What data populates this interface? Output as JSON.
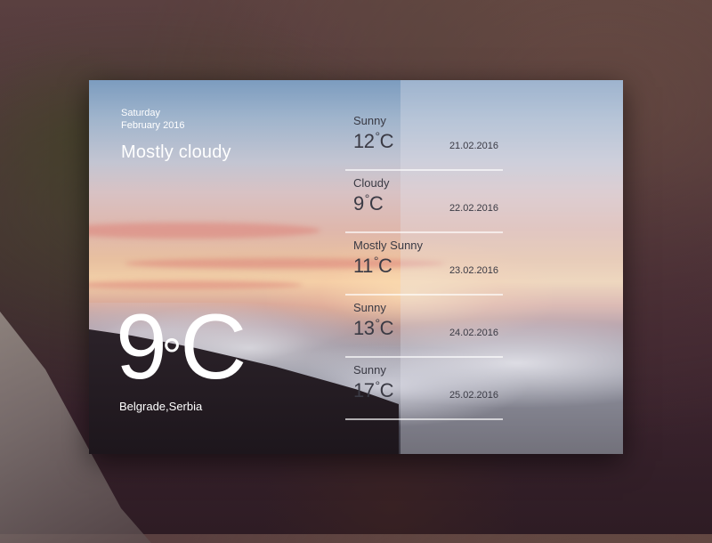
{
  "current": {
    "day": "Saturday",
    "month_year": "February 2016",
    "condition": "Mostly cloudy",
    "temperature": "9",
    "degree_symbol": "°",
    "unit": "C",
    "location": "Belgrade,Serbia"
  },
  "forecast": [
    {
      "condition": "Sunny",
      "temperature": "12",
      "unit": "C",
      "date": "21.02.2016"
    },
    {
      "condition": "Cloudy",
      "temperature": "9",
      "unit": "C",
      "date": "22.02.2016"
    },
    {
      "condition": "Mostly Sunny",
      "temperature": "11",
      "unit": "C",
      "date": "23.02.2016"
    },
    {
      "condition": "Sunny",
      "temperature": "13",
      "unit": "C",
      "date": "24.02.2016"
    },
    {
      "condition": "Sunny",
      "temperature": "17",
      "unit": "C",
      "date": "25.02.2016"
    }
  ],
  "degree_symbol": "°",
  "colors": {
    "text_light": "#ffffff",
    "text_dark": "#3a3a44",
    "panel_overlay": "rgba(230,230,238,0.32)"
  }
}
